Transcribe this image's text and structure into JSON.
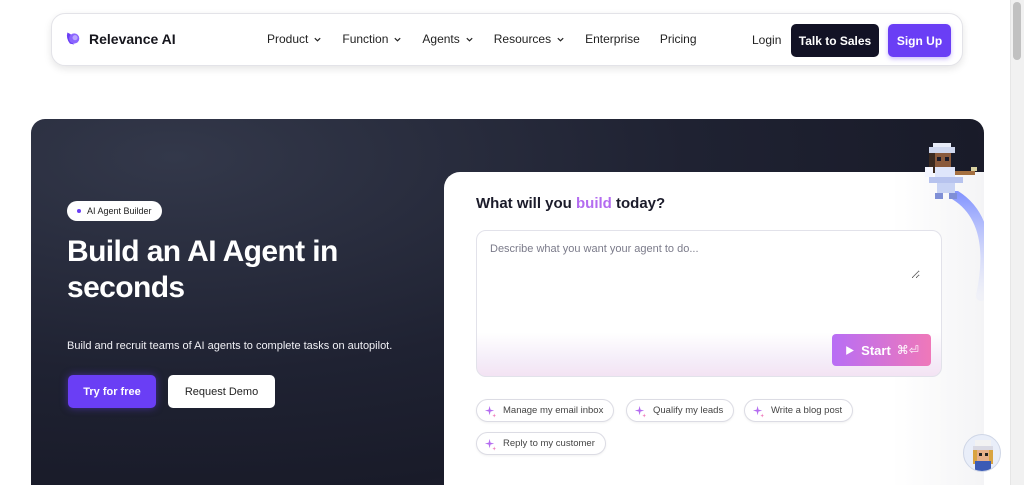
{
  "nav": {
    "brand": "Relevance AI",
    "menu": [
      {
        "label": "Product",
        "has_dropdown": true
      },
      {
        "label": "Function",
        "has_dropdown": true
      },
      {
        "label": "Agents",
        "has_dropdown": true
      },
      {
        "label": "Resources",
        "has_dropdown": true
      },
      {
        "label": "Enterprise",
        "has_dropdown": false
      },
      {
        "label": "Pricing",
        "has_dropdown": false
      }
    ],
    "login": "Login",
    "talk_to_sales": "Talk to Sales",
    "sign_up": "Sign Up"
  },
  "hero": {
    "badge": "AI Agent Builder",
    "title": "Build an AI Agent in seconds",
    "subtitle": "Build and recruit teams of AI agents to complete tasks on autopilot.",
    "try_free": "Try for free",
    "request_demo": "Request Demo"
  },
  "builder": {
    "title_prefix": "What will you ",
    "title_accent": "build",
    "title_suffix": " today?",
    "placeholder": "Describe what you want your agent to do...",
    "start_label": "Start",
    "start_shortcut": "⌘⏎",
    "suggestions": [
      "Manage my email inbox",
      "Qualify my leads",
      "Write a blog post",
      "Reply to my customer"
    ]
  },
  "colors": {
    "brand_purple": "#6a3ef5",
    "dark_button": "#121225",
    "accent_pink": "#ef78b9",
    "accent_violet": "#b46cf0"
  }
}
